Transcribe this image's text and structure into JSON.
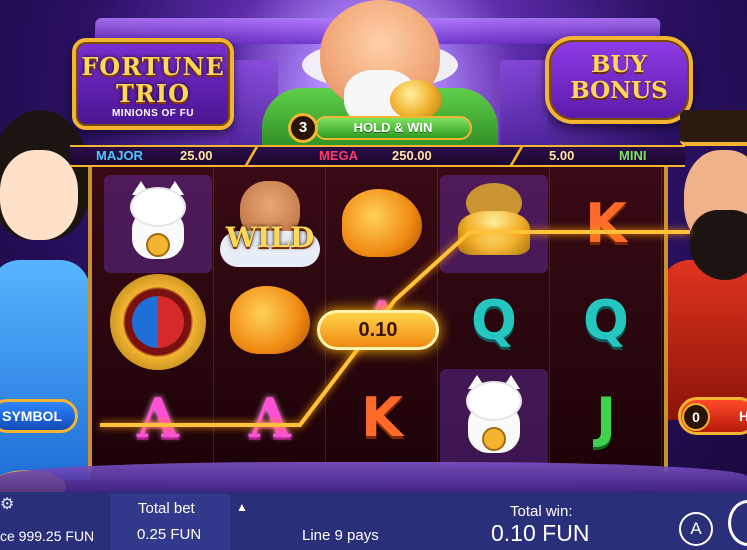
{
  "game": {
    "logo": {
      "line1": "FORTUNE",
      "line2": "TRIO",
      "subtitle": "MINIONS OF FU"
    },
    "buy_bonus": {
      "line1": "BUY",
      "line2": "BONUS"
    },
    "hold_and_win": {
      "count": "3",
      "label": "HOLD & WIN"
    },
    "jackpots": {
      "major": {
        "label": "MAJOR",
        "value": "25.00"
      },
      "mega": {
        "label": "MEGA",
        "value": "250.00"
      },
      "mini": {
        "label": "MINI",
        "value": "5.00"
      }
    },
    "reels": [
      [
        "lucky-cat",
        "yin-yang",
        "A"
      ],
      [
        "WILD",
        "koi-fish",
        "A"
      ],
      [
        "koi-fish",
        "A",
        "K"
      ],
      [
        "gold-ingot",
        "Q",
        "lucky-cat"
      ],
      [
        "K",
        "Q",
        "J"
      ]
    ],
    "wild_text": "WILD",
    "win_badge": "0.10",
    "left_pill": "SYMBOL",
    "right_counter": {
      "count": "0",
      "label": "H"
    }
  },
  "hud": {
    "balance": "ce 999.25 FUN",
    "total_bet_label": "Total bet",
    "total_bet_value": "0.25 FUN",
    "line_pays": "Line 9 pays",
    "total_win_label": "Total win:",
    "total_win_value": "0.10 FUN",
    "auto_label": "A"
  },
  "colors": {
    "gold": "#f2b431",
    "major": "#4fc6ff",
    "mega": "#ff3b6b",
    "mini": "#7ee35e",
    "hud": "#2a2f7a"
  },
  "icons": [
    "gear-icon",
    "arrow-up-icon",
    "autoplay-icon",
    "spin-icon"
  ]
}
